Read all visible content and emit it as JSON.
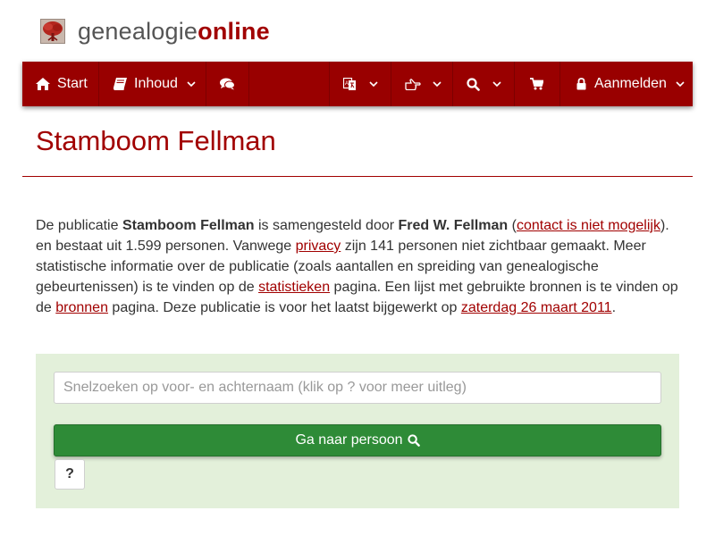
{
  "brand": {
    "name_part1": "genealogie",
    "name_part2": "online",
    "logo_icon": "tree-icon",
    "accent_color": "#990000"
  },
  "nav": {
    "start_label": "Start",
    "start_icon": "home-icon",
    "content_label": "Inhoud",
    "content_icon": "book-icon",
    "chat_icon": "comments-icon",
    "language_icon": "translate-icon",
    "share_icon": "hand-pointer-icon",
    "search_icon": "search-icon",
    "cart_icon": "shopping-cart-icon",
    "login_label": "Aanmelden",
    "login_icon": "lock-icon"
  },
  "page": {
    "title": "Stamboom Fellman"
  },
  "intro": {
    "t1": "De publicatie ",
    "publication": "Stamboom Fellman",
    "t2": " is samengesteld door ",
    "author": "Fred W. Fellman",
    "t3": " (",
    "contact_link": "contact is niet mogelijk",
    "t4": "). en bestaat uit 1.599 personen. Vanwege ",
    "privacy_link": "privacy",
    "t5": " zijn 141 personen niet zichtbaar gemaakt. Meer statistische informatie over de publicatie (zoals aantallen en spreiding van genealogische gebeurtenissen) is te vinden op de ",
    "stats_link": "statistieken",
    "t6": " pagina. Een lijst met gebruikte bronnen is te vinden op de ",
    "sources_link": "bronnen",
    "t7": " pagina. Deze publicatie is voor het laatst bijgewerkt op ",
    "date_link": "zaterdag 26 maart 2011",
    "t8": "."
  },
  "search": {
    "placeholder": "Snelzoeken op voor- en achternaam (klik op ? voor meer uitleg)",
    "value": "",
    "go_label": "Ga naar persoon",
    "help_label": "?",
    "panel_color": "#e3f0da",
    "button_color": "#2e8b37"
  }
}
